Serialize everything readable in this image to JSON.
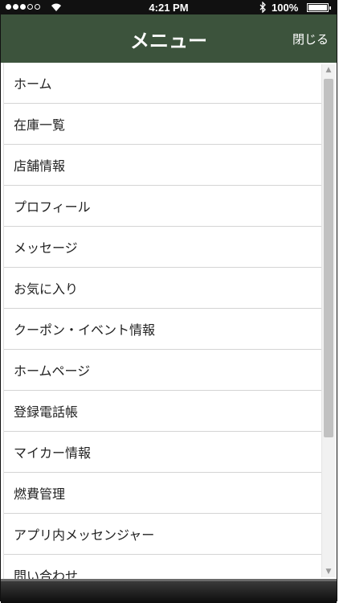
{
  "status_bar": {
    "time": "4:21 PM",
    "battery_text": "100%",
    "battery_level": 1.0,
    "signal_dots": [
      true,
      true,
      true,
      false,
      false
    ],
    "icons": [
      "wifi-icon",
      "bluetooth-icon",
      "battery-icon"
    ]
  },
  "nav": {
    "title": "メニュー",
    "close_label": "閉じる",
    "background": "#3c533c"
  },
  "menu": {
    "items": [
      {
        "label": "ホーム"
      },
      {
        "label": "在庫一覧"
      },
      {
        "label": "店舗情報"
      },
      {
        "label": "プロフィール"
      },
      {
        "label": "メッセージ"
      },
      {
        "label": "お気に入り"
      },
      {
        "label": "クーポン・イベント情報"
      },
      {
        "label": "ホームページ"
      },
      {
        "label": "登録電話帳"
      },
      {
        "label": "マイカー情報"
      },
      {
        "label": "燃費管理"
      },
      {
        "label": "アプリ内メッセンジャー"
      },
      {
        "label": "問い合わせ"
      }
    ]
  },
  "scrollbar": {
    "position": 0.0,
    "visible_fraction": 0.72
  }
}
